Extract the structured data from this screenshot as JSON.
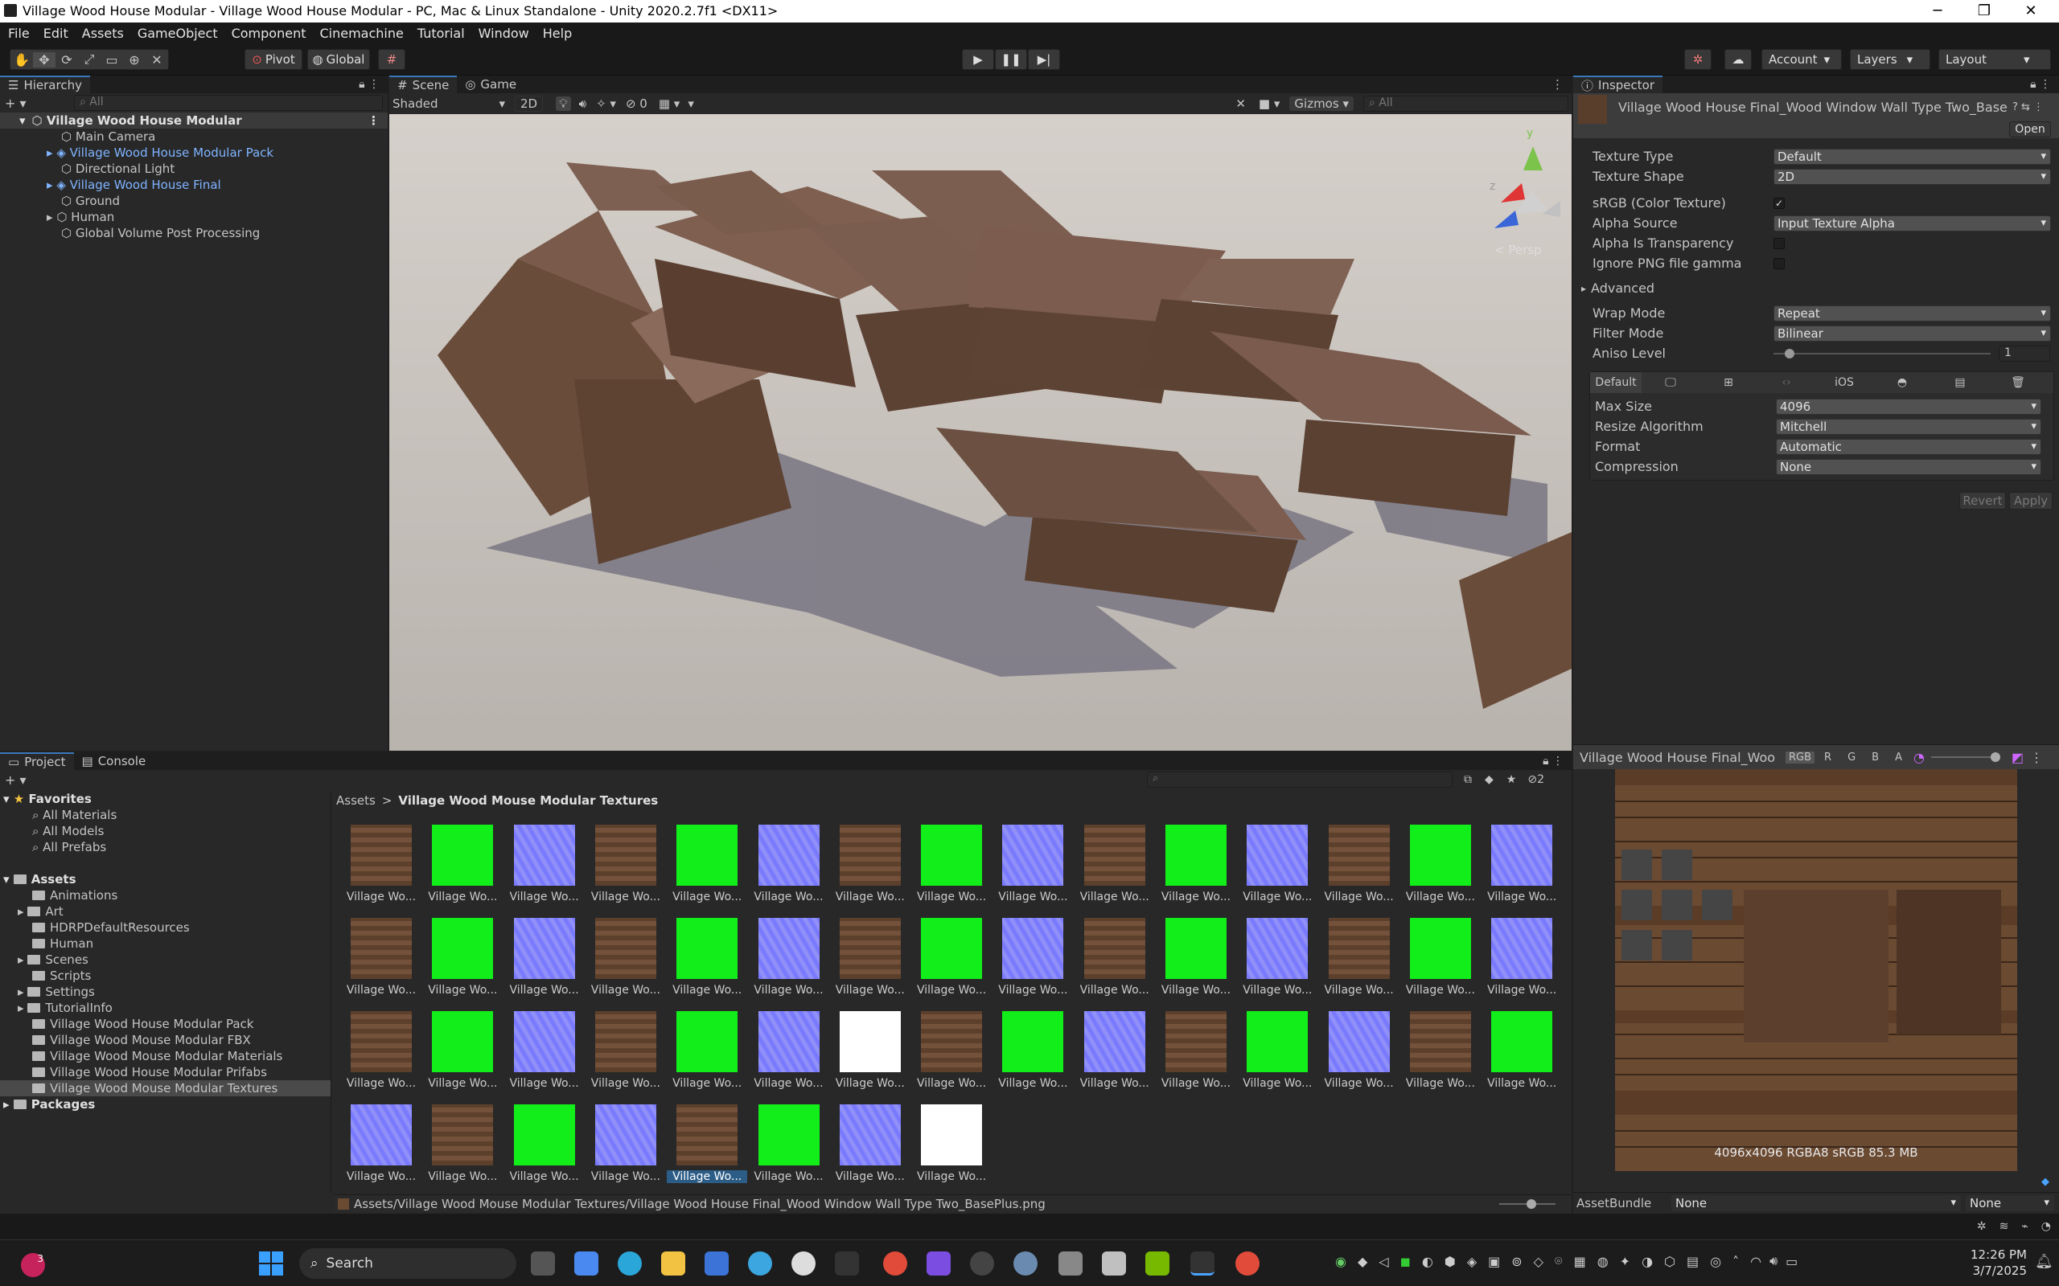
{
  "window": {
    "title": "Village Wood House Modular - Village Wood House Modular - PC, Mac & Linux Standalone - Unity 2020.2.7f1 <DX11>"
  },
  "menu": [
    "File",
    "Edit",
    "Assets",
    "GameObject",
    "Component",
    "Cinemachine",
    "Tutorial",
    "Window",
    "Help"
  ],
  "toolbar": {
    "pivot": "Pivot",
    "global": "Global",
    "account": "Account",
    "layers": "Layers",
    "layout": "Layout"
  },
  "hierarchy": {
    "tab": "Hierarchy",
    "search_placeholder": "All",
    "scene": "Village Wood House Modular",
    "items": [
      {
        "label": "Main Camera",
        "prefab": false,
        "expand": false
      },
      {
        "label": "Village Wood House Modular Pack",
        "prefab": true,
        "expand": true
      },
      {
        "label": "Directional Light",
        "prefab": false,
        "expand": false
      },
      {
        "label": "Village Wood House Final",
        "prefab": true,
        "expand": true
      },
      {
        "label": "Ground",
        "prefab": false,
        "expand": false
      },
      {
        "label": "Human",
        "prefab": false,
        "expand": true
      },
      {
        "label": "Global Volume Post Processing",
        "prefab": false,
        "expand": false
      }
    ]
  },
  "scene": {
    "tab_scene": "Scene",
    "tab_game": "Game",
    "shading": "Shaded",
    "mode2d": "2D",
    "hidden_count": "0",
    "gizmos": "Gizmos",
    "search_placeholder": "All",
    "persp": "< Persp",
    "axis_y": "y",
    "axis_z": "z"
  },
  "inspector": {
    "tab": "Inspector",
    "asset_name": "Village Wood House Final_Wood Window Wall Type Two_Base",
    "open": "Open",
    "texture_type_label": "Texture Type",
    "texture_type": "Default",
    "texture_shape_label": "Texture Shape",
    "texture_shape": "2D",
    "srgb_label": "sRGB (Color Texture)",
    "alpha_source_label": "Alpha Source",
    "alpha_source": "Input Texture Alpha",
    "alpha_transp_label": "Alpha Is Transparency",
    "ignore_gamma_label": "Ignore PNG file gamma",
    "advanced_label": "Advanced",
    "wrap_mode_label": "Wrap Mode",
    "wrap_mode": "Repeat",
    "filter_mode_label": "Filter Mode",
    "filter_mode": "Bilinear",
    "aniso_label": "Aniso Level",
    "aniso_value": "1",
    "platform_default": "Default",
    "platform_ios": "iOS",
    "max_size_label": "Max Size",
    "max_size": "4096",
    "resize_label": "Resize Algorithm",
    "resize": "Mitchell",
    "format_label": "Format",
    "format": "Automatic",
    "compression_label": "Compression",
    "compression": "None",
    "revert": "Revert",
    "apply": "Apply"
  },
  "preview": {
    "title": "Village Wood House Final_Woo",
    "channels": [
      "RGB",
      "R",
      "G",
      "B",
      "A"
    ],
    "info": "4096x4096  RGBA8 sRGB  85.3 MB",
    "assetbundle_label": "AssetBundle",
    "assetbundle": "None",
    "variant": "None"
  },
  "project": {
    "tab_project": "Project",
    "tab_console": "Console",
    "hidden_count": "2",
    "favorites": "Favorites",
    "fav_items": [
      "All Materials",
      "All Models",
      "All Prefabs"
    ],
    "assets": "Assets",
    "folders": [
      "Animations",
      "Art",
      "HDRPDefaultResources",
      "Human",
      "Scenes",
      "Scripts",
      "Settings",
      "TutorialInfo",
      "Village Wood House Modular Pack",
      "Village Wood Mouse Modular FBX",
      "Village Wood Mouse Modular Materials",
      "Village Wood House Modular Prifabs",
      "Village Wood Mouse Modular Textures"
    ],
    "packages": "Packages",
    "breadcrumb_root": "Assets",
    "breadcrumb_sep": ">",
    "breadcrumb_folder": "Village Wood Mouse Modular Textures",
    "thumb_label": "Village Wo...",
    "status_path": "Assets/Village Wood Mouse Modular Textures/Village Wood House Final_Wood Window Wall Type Two_BasePlus.png"
  },
  "taskbar": {
    "search": "Search",
    "time": "12:26 PM",
    "date": "3/7/2025",
    "notif": "3"
  },
  "colors": {
    "wood": "#6b4a35",
    "green": "#12ee1a",
    "normal": "#8080ff",
    "white": "#ffffff",
    "select": "#2c5d87",
    "accent": "#3a79bb"
  }
}
